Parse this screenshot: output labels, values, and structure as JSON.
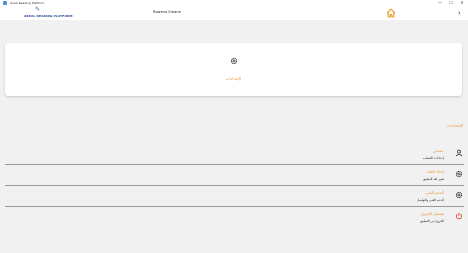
{
  "window": {
    "title": "Areal Reading Platform",
    "minimize": "—",
    "maximize": "☐",
    "close": "✕"
  },
  "appbar": {
    "brand": "AREAL READING PLATFORM",
    "username": "Rowena Smane",
    "back": "›"
  },
  "card": {
    "label": "الإعدادات"
  },
  "section_title": "الإعدادات",
  "rows": [
    {
      "title": "حسابي",
      "subtitle": "إعدادات الحساب",
      "icon": "user-icon"
    },
    {
      "title": "إعداد اللغة",
      "subtitle": "تغيير لغة التطبيق",
      "icon": "gear-icon"
    },
    {
      "title": "الدعم الفني",
      "subtitle": "الدعم الفني والتواصل",
      "icon": "gear-icon"
    },
    {
      "title": "تسجيل الخروج",
      "subtitle": "الخروج من التطبيق",
      "icon": "power-icon"
    }
  ],
  "colors": {
    "accent": "#e8953a",
    "logout": "#d9342b",
    "home": "#e89a2a",
    "brand": "#1d3f8a"
  }
}
